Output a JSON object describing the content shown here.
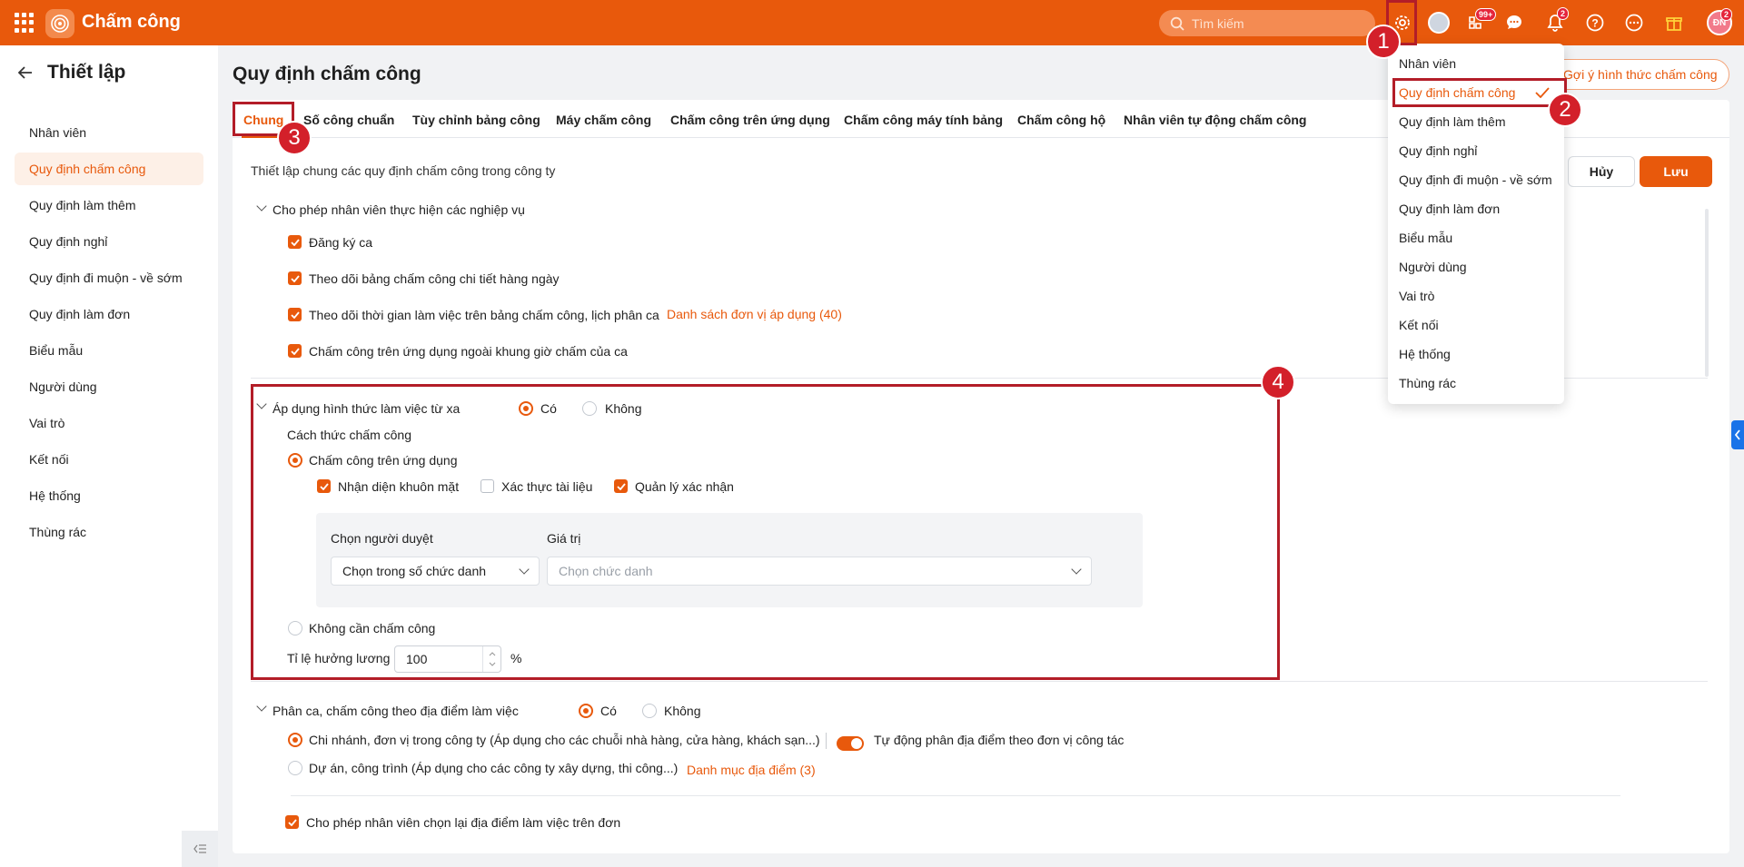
{
  "topbar": {
    "app_title": "Chấm công",
    "search_placeholder": "Tìm kiếm",
    "badges": {
      "apps": "99+",
      "notifications": "2",
      "avatar": "2"
    },
    "avatar_initials": "ĐN",
    "accent": "#e8590c"
  },
  "sidebar": {
    "title": "Thiết lập",
    "items": [
      {
        "label": "Nhân viên"
      },
      {
        "label": "Quy định chấm công",
        "active": true
      },
      {
        "label": "Quy định làm thêm"
      },
      {
        "label": "Quy định nghỉ"
      },
      {
        "label": "Quy định đi muộn - về sớm"
      },
      {
        "label": "Quy định làm đơn"
      },
      {
        "label": "Biểu mẫu"
      },
      {
        "label": "Người dùng"
      },
      {
        "label": "Vai trò"
      },
      {
        "label": "Kết nối"
      },
      {
        "label": "Hệ thống"
      },
      {
        "label": "Thùng rác"
      }
    ]
  },
  "page": {
    "title": "Quy định chấm công",
    "suggest_button": "Gợi ý hình thức chấm công"
  },
  "tabs": [
    {
      "label": "Chung",
      "active": true
    },
    {
      "label": "Số công chuẩn"
    },
    {
      "label": "Tùy chỉnh bảng công"
    },
    {
      "label": "Máy chấm công"
    },
    {
      "label": "Chấm công trên ứng dụng"
    },
    {
      "label": "Chấm công máy tính bảng"
    },
    {
      "label": "Chấm công hộ"
    },
    {
      "label": "Nhân viên tự động chấm công"
    }
  ],
  "actions": {
    "cancel": "Hủy",
    "save": "Lưu"
  },
  "general": {
    "description": "Thiết lập chung các quy định chấm công trong công ty",
    "section1": {
      "title": "Cho phép nhân viên thực hiện các nghiệp vụ",
      "items": [
        {
          "label": "Đăng ký ca",
          "checked": true
        },
        {
          "label": "Theo dõi bảng chấm công chi tiết hàng ngày",
          "checked": true
        },
        {
          "label": "Theo dõi thời gian làm việc trên bảng chấm công, lịch phân ca",
          "checked": true,
          "link": "Danh sách đơn vị áp dụng (40)"
        },
        {
          "label": "Chấm công trên ứng dụng ngoài khung giờ chấm của ca",
          "checked": true
        }
      ]
    },
    "remote": {
      "title": "Áp dụng hình thức làm việc từ xa",
      "yes": "Có",
      "no": "Không",
      "selected": "Có",
      "method_label": "Cách thức chấm công",
      "method_app": "Chấm công trên ứng dụng",
      "options": [
        {
          "label": "Nhận diện khuôn mặt",
          "checked": true
        },
        {
          "label": "Xác thực tài liệu",
          "checked": false
        },
        {
          "label": "Quản lý xác nhận",
          "checked": true
        }
      ],
      "approver_label": "Chọn người duyệt",
      "value_label": "Giá trị",
      "approver_select": "Chọn trong số chức danh",
      "value_placeholder": "Chọn chức danh",
      "no_attendance": "Không cần chấm công",
      "salary_ratio_label": "Tỉ lệ hưởng lương",
      "salary_ratio_value": "100",
      "salary_ratio_unit": "%"
    },
    "location": {
      "title": "Phân ca, chấm công theo địa điểm làm việc",
      "yes": "Có",
      "no": "Không",
      "option1": "Chi nhánh, đơn vị trong công ty (Áp dụng cho các chuỗi nhà hàng, cửa hàng, khách sạn...)",
      "auto_assign": "Tự động phân địa điểm theo đơn vị công tác",
      "option2": "Dự án, công trình (Áp dụng cho các công ty xây dựng, thi công...)",
      "option2_link": "Danh mục địa điểm (3)",
      "allow_reselect": "Cho phép nhân viên chọn lại địa điểm làm việc trên đơn"
    }
  },
  "dropdown": {
    "items": [
      {
        "label": "Nhân viên"
      },
      {
        "label": "Quy định chấm công",
        "active": true
      },
      {
        "label": "Quy định làm thêm"
      },
      {
        "label": "Quy định nghỉ"
      },
      {
        "label": "Quy định đi muộn - về sớm"
      },
      {
        "label": "Quy định làm đơn"
      },
      {
        "label": "Biểu mẫu"
      },
      {
        "label": "Người dùng"
      },
      {
        "label": "Vai trò"
      },
      {
        "label": "Kết nối"
      },
      {
        "label": "Hệ thống"
      },
      {
        "label": "Thùng rác"
      }
    ]
  },
  "annotations": [
    "1",
    "2",
    "3",
    "4"
  ]
}
